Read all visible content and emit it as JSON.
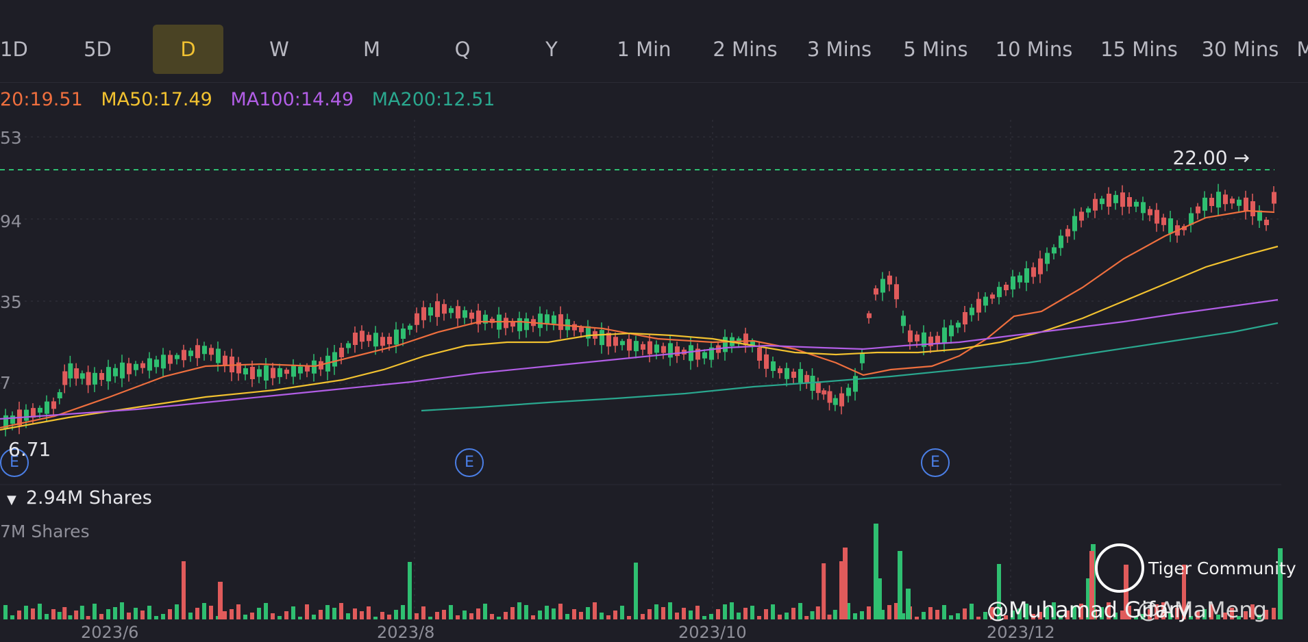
{
  "tabs": [
    "1D",
    "5D",
    "D",
    "W",
    "M",
    "Q",
    "Y",
    "1 Min",
    "2 Mins",
    "3 Mins",
    "5 Mins",
    "10 Mins",
    "15 Mins",
    "30 Mins",
    "M"
  ],
  "active_tab": "D",
  "ma": [
    {
      "label": "20:19.51",
      "color": "#ef6f3e"
    },
    {
      "label": "MA50:17.49",
      "color": "#f2c230"
    },
    {
      "label": "MA100:14.49",
      "color": "#b25ee6"
    },
    {
      "label": "MA200:12.51",
      "color": "#2aa88f"
    }
  ],
  "price_axis_labels": [
    "53",
    "94",
    "35",
    "7"
  ],
  "current_price_label": "22.00",
  "low_label": "6.71",
  "volume": {
    "header": "2.94M Shares",
    "subheader": "7M Shares"
  },
  "date_labels": [
    "2023/6",
    "2023/8",
    "2023/10",
    "2023/12"
  ],
  "earnings_badge": "E",
  "watermark": {
    "logo_text": "Tiger Community",
    "handle": "@Muhamad Gifary",
    "handle2": "@AMaMeng"
  },
  "colors": {
    "up": "#2fbf71",
    "down": "#e05b5b",
    "bg": "#1e1e26",
    "grid": "#34343f"
  },
  "chart_data": {
    "type": "candlestick",
    "x_axis": [
      "2023/6",
      "2023/8",
      "2023/10",
      "2023/12"
    ],
    "y_ticks": [
      53,
      94,
      35,
      7
    ],
    "last_price": 22.0,
    "low": 6.71,
    "ma_values": {
      "MA20": 19.51,
      "MA50": 17.49,
      "MA100": 14.49,
      "MA200": 12.51
    }
  }
}
